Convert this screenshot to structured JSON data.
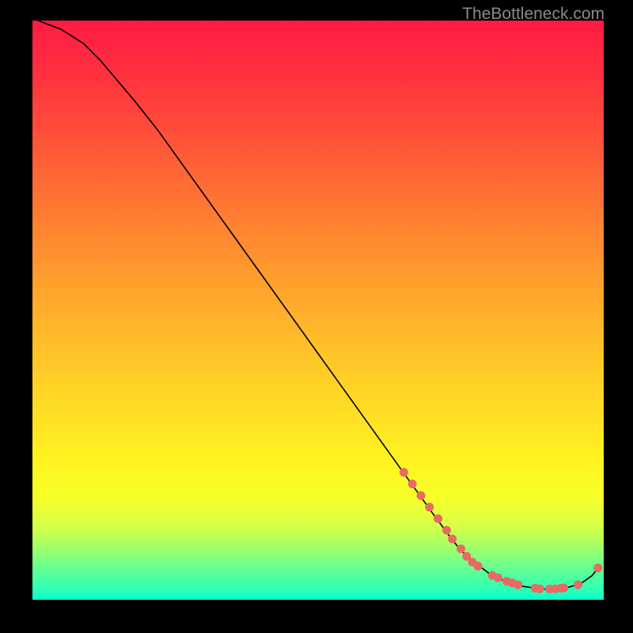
{
  "watermark": "TheBottleneck.com",
  "chart_data": {
    "type": "line",
    "title": "",
    "xlabel": "",
    "ylabel": "",
    "xlim": [
      0,
      100
    ],
    "ylim": [
      0,
      100
    ],
    "series": [
      {
        "name": "curve",
        "x": [
          1,
          5,
          9,
          12,
          15,
          18,
          22,
          26,
          30,
          34,
          38,
          42,
          46,
          50,
          54,
          58,
          62,
          66,
          70,
          73,
          75,
          78,
          80,
          82,
          84,
          86,
          88,
          90,
          92,
          94,
          96,
          98,
          99
        ],
        "y": [
          100,
          98.5,
          96,
          93,
          89.5,
          86,
          81,
          75.5,
          70,
          64.5,
          59,
          53.5,
          48,
          42.5,
          37,
          31.5,
          26,
          20.5,
          15,
          11,
          8.5,
          6,
          4.5,
          3.5,
          2.8,
          2.3,
          2,
          1.8,
          1.9,
          2.2,
          2.8,
          4.2,
          5.5
        ]
      }
    ],
    "markers": [
      {
        "x": 65,
        "y": 22
      },
      {
        "x": 66.5,
        "y": 20
      },
      {
        "x": 68,
        "y": 18
      },
      {
        "x": 69.5,
        "y": 16
      },
      {
        "x": 71,
        "y": 14
      },
      {
        "x": 72.5,
        "y": 12
      },
      {
        "x": 73.5,
        "y": 10.5
      },
      {
        "x": 75,
        "y": 8.8
      },
      {
        "x": 76,
        "y": 7.5
      },
      {
        "x": 77,
        "y": 6.5
      },
      {
        "x": 78,
        "y": 5.8
      },
      {
        "x": 80.5,
        "y": 4.2
      },
      {
        "x": 81.5,
        "y": 3.8
      },
      {
        "x": 83,
        "y": 3.2
      },
      {
        "x": 84,
        "y": 2.9
      },
      {
        "x": 85,
        "y": 2.6
      },
      {
        "x": 88,
        "y": 2.0
      },
      {
        "x": 88.8,
        "y": 1.9
      },
      {
        "x": 90.5,
        "y": 1.85
      },
      {
        "x": 91.5,
        "y": 1.9
      },
      {
        "x": 92.5,
        "y": 2.0
      },
      {
        "x": 93,
        "y": 2.05
      },
      {
        "x": 95.5,
        "y": 2.6
      },
      {
        "x": 99,
        "y": 5.5
      }
    ],
    "marker_color": "#e86a63",
    "line_color": "#000000"
  }
}
